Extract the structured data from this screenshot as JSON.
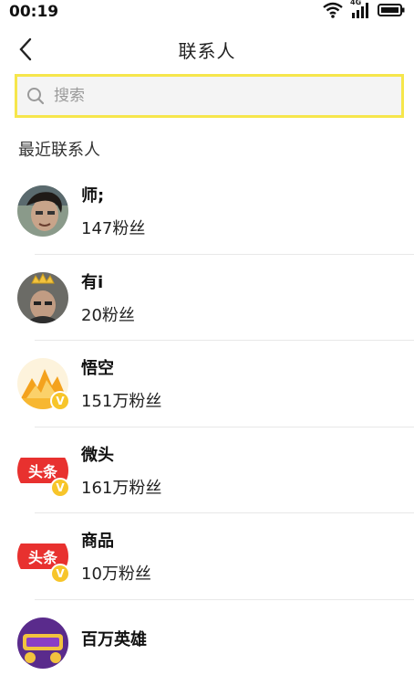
{
  "status_bar": {
    "time": "00:19",
    "network": "4G"
  },
  "header": {
    "title": "联系人"
  },
  "search": {
    "placeholder": "搜索"
  },
  "section": {
    "title": "最近联系人"
  },
  "contacts": [
    {
      "name": "师;",
      "fans": "147粉丝",
      "verified": false,
      "avatar": "person-photo"
    },
    {
      "name": "有i",
      "fans": "20粉丝",
      "verified": false,
      "avatar": "person-with-crown"
    },
    {
      "name": "悟空",
      "fans": "151万粉丝",
      "verified": true,
      "avatar": "wukong-logo"
    },
    {
      "name": "微头",
      "fans": "161万粉丝",
      "verified": true,
      "avatar": "toutiao-logo"
    },
    {
      "name": "商品",
      "fans": "10万粉丝",
      "verified": true,
      "avatar": "toutiao-logo"
    },
    {
      "name": "百万英雄",
      "fans": "",
      "verified": false,
      "avatar": "game-logo"
    }
  ],
  "colors": {
    "search_highlight": "#f6e64b",
    "verified": "#f7c52a",
    "toutiao_red": "#e8312f"
  }
}
